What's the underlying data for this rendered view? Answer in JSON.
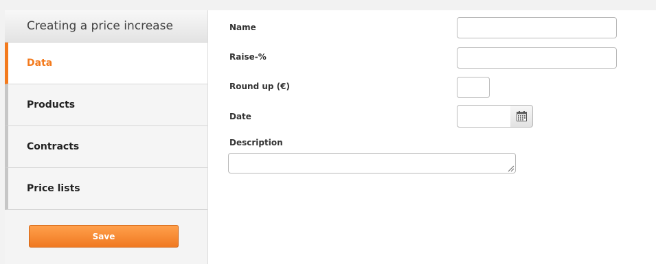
{
  "sidebar": {
    "title": "Creating a price increase",
    "items": [
      {
        "label": "Data",
        "active": true
      },
      {
        "label": "Products",
        "active": false
      },
      {
        "label": "Contracts",
        "active": false
      },
      {
        "label": "Price lists",
        "active": false
      }
    ],
    "save_label": "Save"
  },
  "form": {
    "name_label": "Name",
    "name_value": "",
    "raise_label": "Raise-%",
    "raise_value": "",
    "roundup_label": "Round up (€)",
    "roundup_value": "",
    "date_label": "Date",
    "date_value": "",
    "description_label": "Description",
    "description_value": ""
  },
  "colors": {
    "accent": "#f37a1d",
    "button": "#f58a32"
  },
  "icons": {
    "date_picker": "calendar-icon"
  }
}
